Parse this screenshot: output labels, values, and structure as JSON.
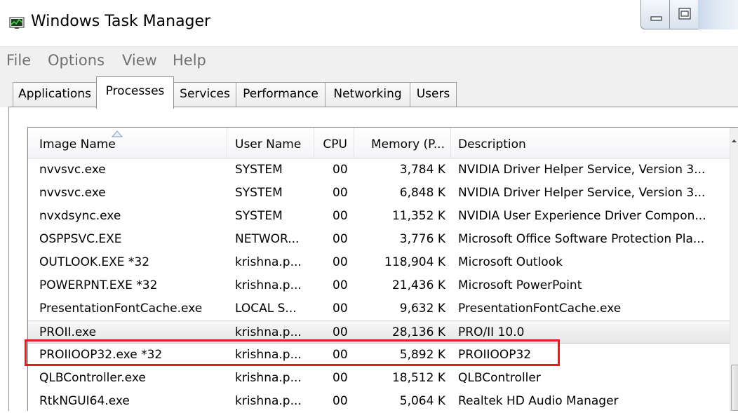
{
  "window": {
    "title": "Windows Task Manager",
    "icon": "task-manager-icon"
  },
  "menu": {
    "items": [
      "File",
      "Options",
      "View",
      "Help"
    ]
  },
  "tabs": [
    {
      "label": "Applications",
      "active": false
    },
    {
      "label": "Processes",
      "active": true
    },
    {
      "label": "Services",
      "active": false
    },
    {
      "label": "Performance",
      "active": false
    },
    {
      "label": "Networking",
      "active": false
    },
    {
      "label": "Users",
      "active": false
    }
  ],
  "table": {
    "columns": [
      "Image Name",
      "User Name",
      "CPU",
      "Memory (P...",
      "Description"
    ],
    "sort_column": "Image Name",
    "sort_direction": "ascending",
    "rows": [
      {
        "image": "nvvsvc.exe",
        "user": "SYSTEM",
        "cpu": "00",
        "memory": "3,784 K",
        "description": "NVIDIA Driver Helper Service, Version 3..."
      },
      {
        "image": "nvvsvc.exe",
        "user": "SYSTEM",
        "cpu": "00",
        "memory": "6,848 K",
        "description": "NVIDIA Driver Helper Service, Version 3..."
      },
      {
        "image": "nvxdsync.exe",
        "user": "SYSTEM",
        "cpu": "00",
        "memory": "11,352 K",
        "description": "NVIDIA User Experience Driver Compon..."
      },
      {
        "image": "OSPPSVC.EXE",
        "user": "NETWOR...",
        "cpu": "00",
        "memory": "3,776 K",
        "description": "Microsoft Office Software Protection Pla..."
      },
      {
        "image": "OUTLOOK.EXE *32",
        "user": "krishna.p...",
        "cpu": "00",
        "memory": "118,904 K",
        "description": "Microsoft Outlook"
      },
      {
        "image": "POWERPNT.EXE *32",
        "user": "krishna.p...",
        "cpu": "00",
        "memory": "21,436 K",
        "description": "Microsoft PowerPoint"
      },
      {
        "image": "PresentationFontCache.exe",
        "user": "LOCAL S...",
        "cpu": "00",
        "memory": "9,632 K",
        "description": "PresentationFontCache.exe"
      },
      {
        "image": "PROII.exe",
        "user": "krishna.p...",
        "cpu": "00",
        "memory": "28,136 K",
        "description": "PRO/II 10.0"
      },
      {
        "image": "PROIIOOP32.exe *32",
        "user": "krishna.p...",
        "cpu": "00",
        "memory": "5,892 K",
        "description": "PROIIOOP32"
      },
      {
        "image": "QLBController.exe",
        "user": "krishna.p...",
        "cpu": "00",
        "memory": "18,512 K",
        "description": "QLBController"
      },
      {
        "image": "RtkNGUI64.exe",
        "user": "krishna.p...",
        "cpu": "00",
        "memory": "5,064 K",
        "description": "Realtek HD Audio Manager"
      }
    ],
    "selected_row": 7,
    "highlighted_row": 8
  },
  "colors": {
    "highlight_box": "#e21a23",
    "menu_text": "#707070",
    "selected_row": "#e7e7e7"
  }
}
